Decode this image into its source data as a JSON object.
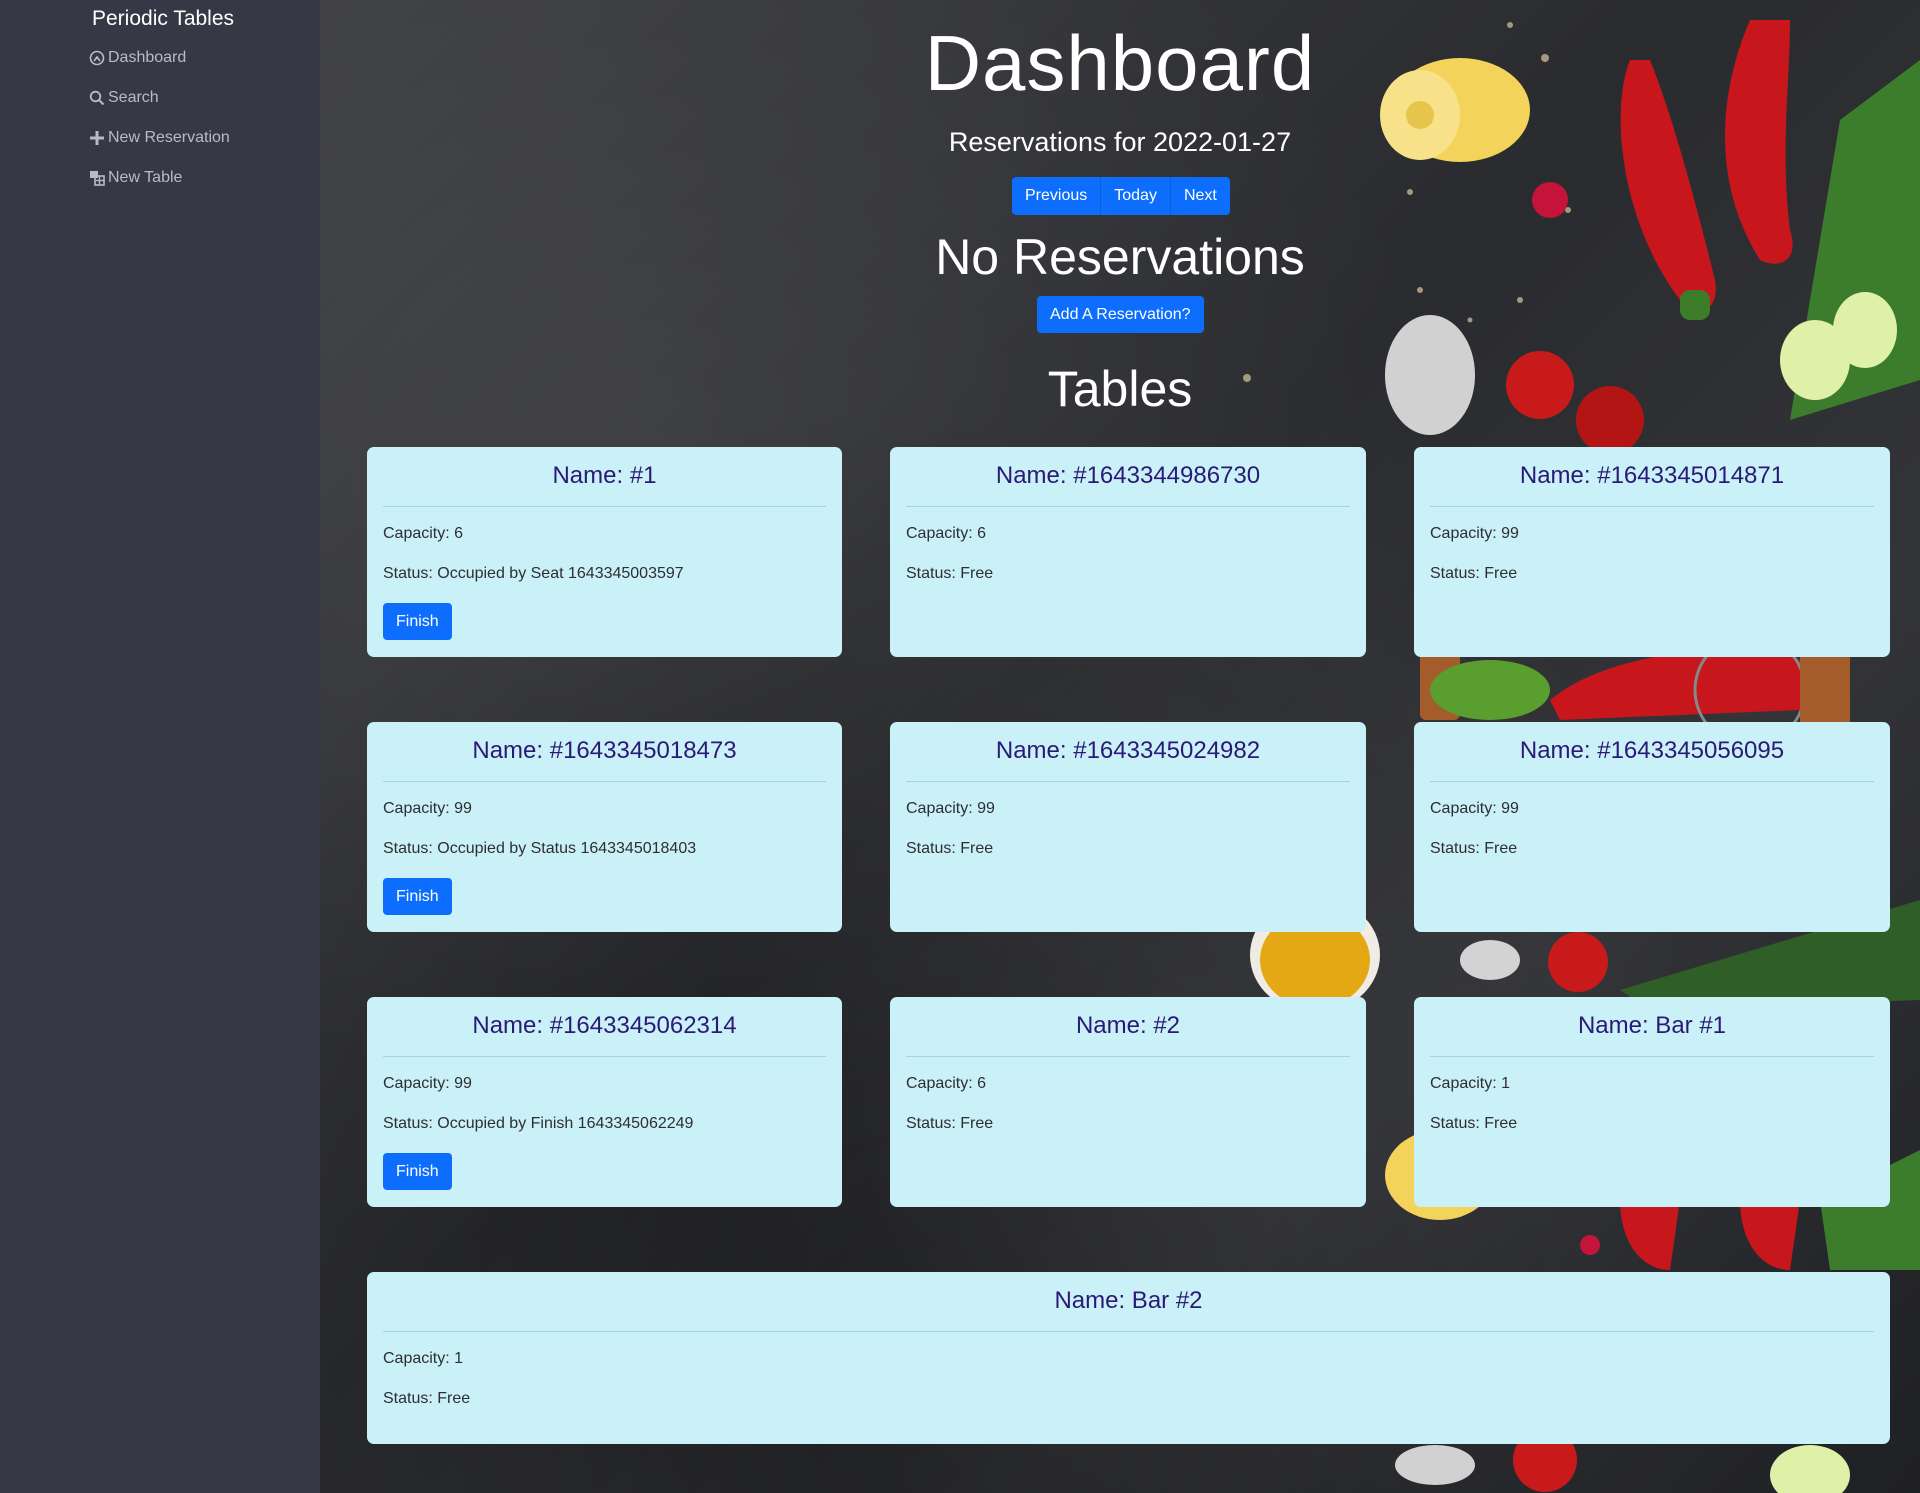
{
  "sidebar": {
    "brand": "Periodic Tables",
    "items": [
      {
        "label": "Dashboard",
        "icon": "dashboard-icon"
      },
      {
        "label": "Search",
        "icon": "search-icon"
      },
      {
        "label": "New Reservation",
        "icon": "plus-icon"
      },
      {
        "label": "New Table",
        "icon": "new-table-icon"
      }
    ]
  },
  "header": {
    "title": "Dashboard",
    "date_heading": "Reservations for 2022-01-27",
    "nav": {
      "previous": "Previous",
      "today": "Today",
      "next": "Next"
    },
    "empty_message": "No Reservations",
    "add_button": "Add A Reservation?"
  },
  "tables_section": {
    "heading": "Tables",
    "cards": [
      {
        "name": "Name: #1",
        "capacity": "Capacity: 6",
        "status": "Status: Occupied by Seat 1643345003597",
        "finish": "Finish"
      },
      {
        "name": "Name: #1643344986730",
        "capacity": "Capacity: 6",
        "status": "Status: Free"
      },
      {
        "name": "Name: #1643345014871",
        "capacity": "Capacity: 99",
        "status": "Status: Free"
      },
      {
        "name": "Name: #1643345018473",
        "capacity": "Capacity: 99",
        "status": "Status: Occupied by Status 1643345018403",
        "finish": "Finish"
      },
      {
        "name": "Name: #1643345024982",
        "capacity": "Capacity: 99",
        "status": "Status: Free"
      },
      {
        "name": "Name: #1643345056095",
        "capacity": "Capacity: 99",
        "status": "Status: Free"
      },
      {
        "name": "Name: #1643345062314",
        "capacity": "Capacity: 99",
        "status": "Status: Occupied by Finish 1643345062249",
        "finish": "Finish"
      },
      {
        "name": "Name: #2",
        "capacity": "Capacity: 6",
        "status": "Status: Free"
      },
      {
        "name": "Name: Bar #1",
        "capacity": "Capacity: 1",
        "status": "Status: Free"
      },
      {
        "name": "Name: Bar #2",
        "capacity": "Capacity: 1",
        "status": "Status: Free"
      }
    ]
  },
  "colors": {
    "sidebar_bg": "#363845",
    "accent": "#0d6efd",
    "card_bg": "#caf0f8",
    "card_title": "#2a1a76"
  }
}
